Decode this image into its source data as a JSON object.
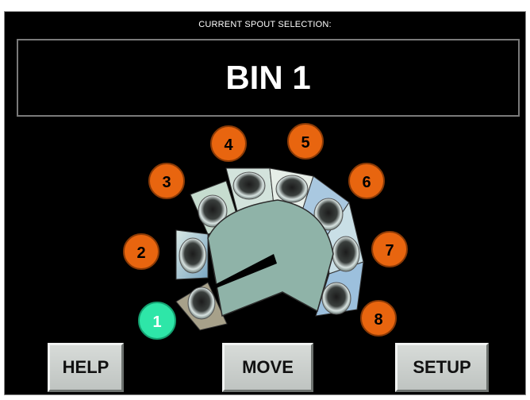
{
  "header": {
    "caption": "CURRENT SPOUT SELECTION:"
  },
  "selection": {
    "bin": "BIN 1"
  },
  "spouts": [
    {
      "label": "1",
      "state": "selected",
      "color": "#2ee6a8"
    },
    {
      "label": "2",
      "state": "available",
      "color": "#e8650f"
    },
    {
      "label": "3",
      "state": "available",
      "color": "#e8650f"
    },
    {
      "label": "4",
      "state": "available",
      "color": "#e8650f"
    },
    {
      "label": "5",
      "state": "available",
      "color": "#e8650f"
    },
    {
      "label": "6",
      "state": "available",
      "color": "#e8650f"
    },
    {
      "label": "7",
      "state": "available",
      "color": "#e8650f"
    },
    {
      "label": "8",
      "state": "available",
      "color": "#e8650f"
    }
  ],
  "buttons": {
    "help": "HELP",
    "move": "MOVE",
    "setup": "SETUP"
  },
  "colors": {
    "background": "#000000",
    "hub": "#8fb3a8",
    "pointer": "#000000",
    "button_face": "#c9cdca"
  }
}
